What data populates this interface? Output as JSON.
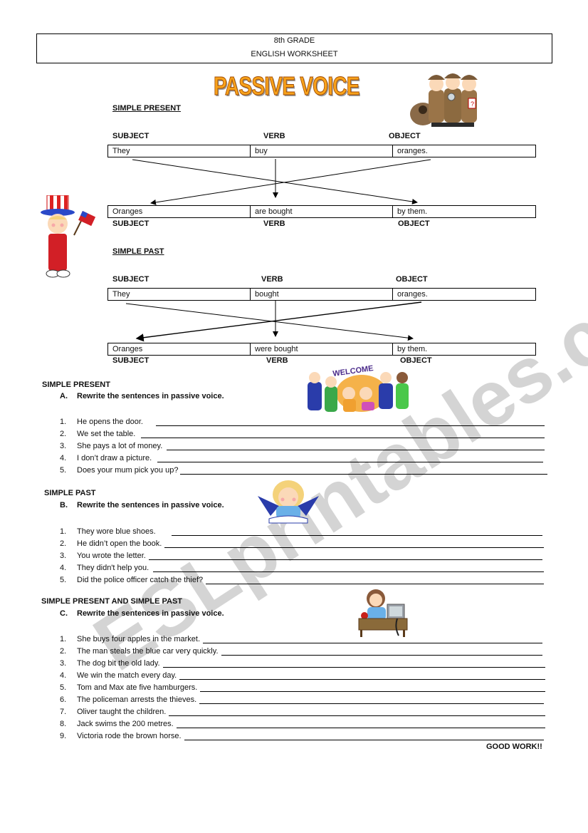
{
  "header": {
    "line1": "8th GRADE",
    "line2": "ENGLISH WORKSHEET"
  },
  "title": "PASSIVE VOICE",
  "diagrams": [
    {
      "section": "SIMPLE PRESENT",
      "labels": [
        "SUBJECT",
        "VERB",
        "OBJECT"
      ],
      "active": [
        "They",
        "buy",
        "oranges."
      ],
      "passive": [
        "Oranges",
        "are bought",
        "by them."
      ],
      "bottom_labels": [
        "SUBJECT",
        "VERB",
        "OBJECT"
      ]
    },
    {
      "section": "SIMPLE PAST",
      "labels": [
        "SUBJECT",
        "VERB",
        "OBJECT"
      ],
      "active": [
        "They",
        "bought",
        "oranges."
      ],
      "passive": [
        "Oranges",
        "were bought",
        "by them."
      ],
      "bottom_labels": [
        "SUBJECT",
        "VERB",
        "OBJECT"
      ]
    }
  ],
  "exercises": [
    {
      "section": "SIMPLE PRESENT",
      "letter": "A.",
      "instruction": "Rewrite the sentences in passive voice.",
      "items": [
        {
          "n": "1.",
          "text": "He opens the door."
        },
        {
          "n": "2.",
          "text": "We set the table."
        },
        {
          "n": "3.",
          "text": "She pays a lot of money."
        },
        {
          "n": "4.",
          "text": "I don’t draw a picture."
        },
        {
          "n": "5.",
          "text": "Does your mum pick you up?"
        }
      ]
    },
    {
      "section": "SIMPLE PAST",
      "letter": "B.",
      "instruction": "Rewrite the sentences in passive voice.",
      "items": [
        {
          "n": "1.",
          "text": "They wore blue shoes."
        },
        {
          "n": "2.",
          "text": "He didn’t open the book."
        },
        {
          "n": "3.",
          "text": "You wrote the letter."
        },
        {
          "n": "4.",
          "text": "They didn't help you."
        },
        {
          "n": "5.",
          "text": "Did the police officer catch the thief?"
        }
      ]
    },
    {
      "section": "SIMPLE PRESENT AND SIMPLE PAST",
      "letter": "C.",
      "instruction": "Rewrite the sentences in passive voice.",
      "items": [
        {
          "n": "1.",
          "text": "She buys four apples in the market."
        },
        {
          "n": "2.",
          "text": "The man steals the blue car very quickly."
        },
        {
          "n": "3.",
          "text": "The dog bit the old lady."
        },
        {
          "n": "4.",
          "text": "We win the match every day."
        },
        {
          "n": "5.",
          "text": "Tom and Max ate five hamburgers."
        },
        {
          "n": "6.",
          "text": "The policeman arrests the thieves."
        },
        {
          "n": "7.",
          "text": "Oliver taught the children."
        },
        {
          "n": "8.",
          "text": "Jack swims the 200 metres."
        },
        {
          "n": "9.",
          "text": "Victoria rode the brown horse."
        }
      ]
    }
  ],
  "footer": "GOOD WORK!!",
  "watermark": "ESLprintables.com",
  "clipart": {
    "detectives": "detectives-clipart",
    "uncle_sam_kid": "uncle-sam-kid-clipart",
    "welcome_kids": "welcome-kids-clipart",
    "reading_girl": "reading-girl-clipart",
    "teacher_desk": "teacher-at-desk-clipart",
    "welcome_text": "WELCOME"
  }
}
